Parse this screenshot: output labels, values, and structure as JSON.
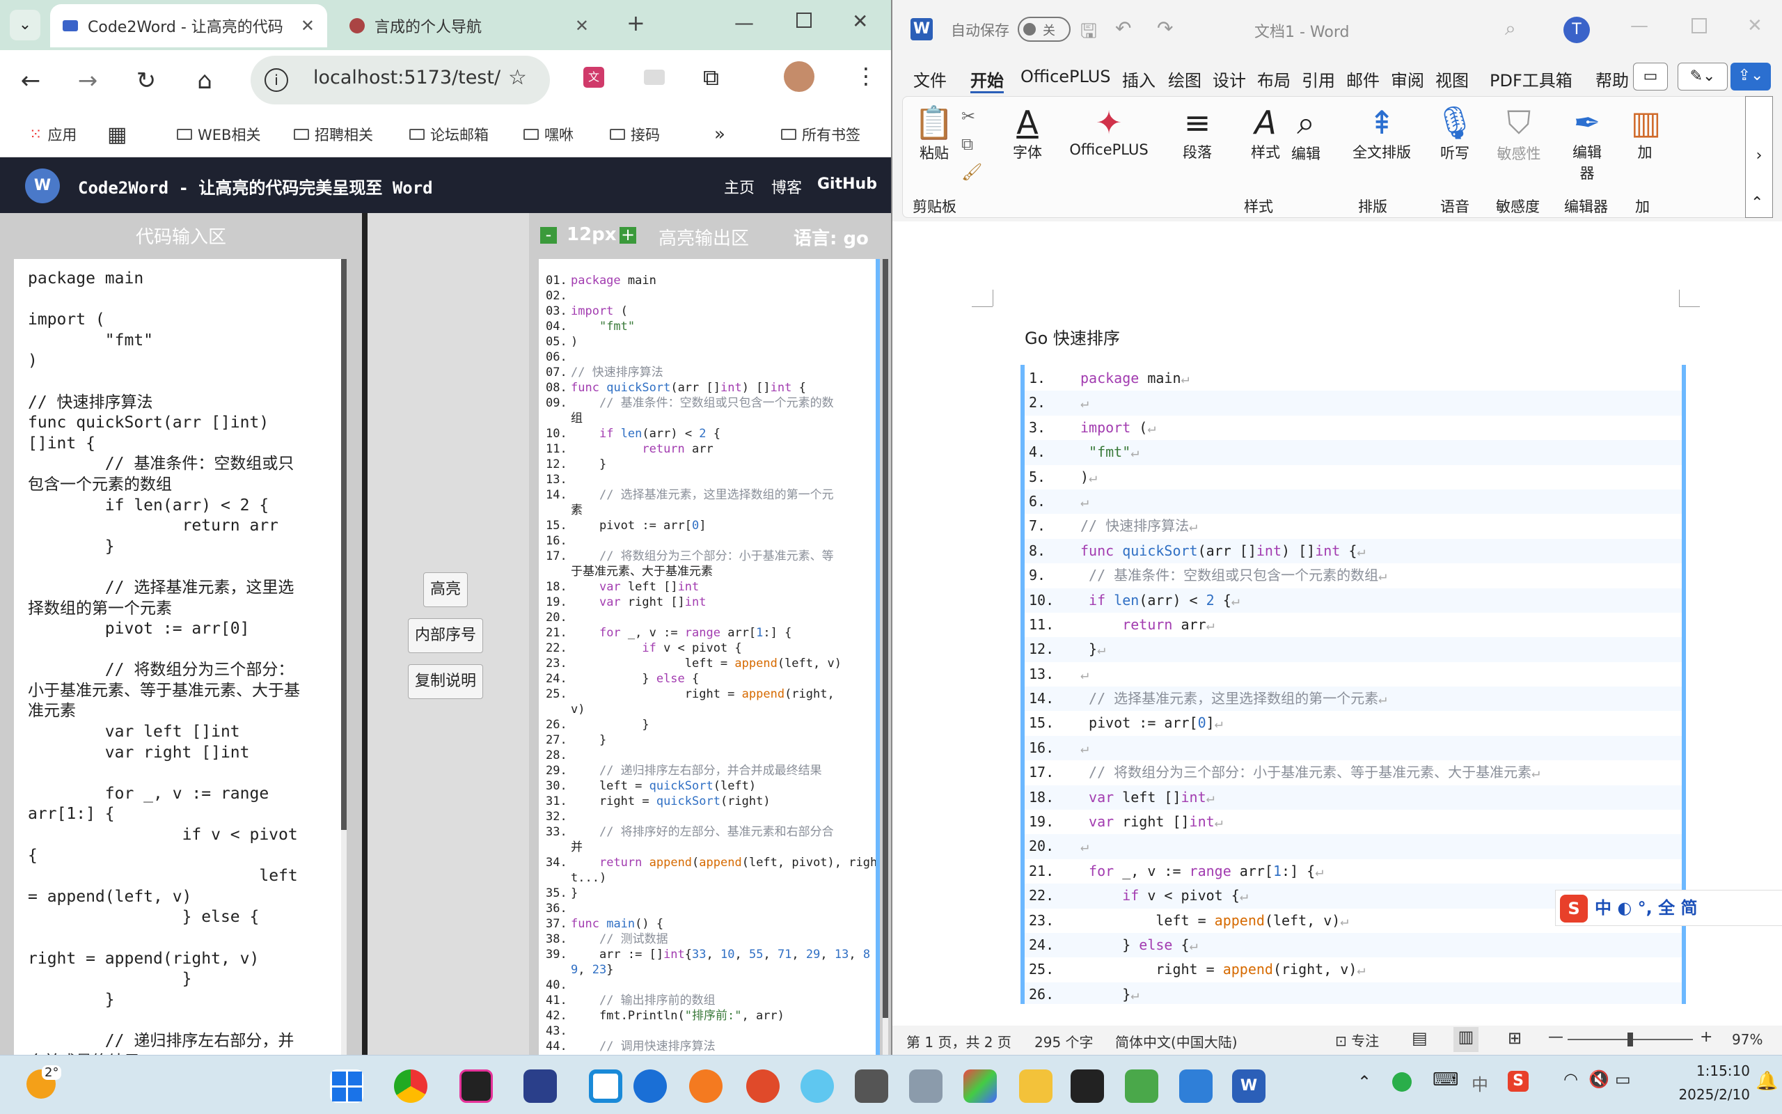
{
  "browser": {
    "tabs": [
      {
        "title": "Code2Word - 让高亮的代码"
      },
      {
        "title": "言成的个人导航"
      }
    ],
    "url": "localhost:5173/test/",
    "bookmarks": [
      "应用",
      "WEB相关",
      "招聘相关",
      "论坛邮箱",
      "嘿咻",
      "接码"
    ],
    "all_bookmarks": "所有书签",
    "more": "»"
  },
  "app": {
    "logo": "W",
    "title": "Code2Word - 让高亮的代码完美呈现至 Word",
    "nav": [
      "主页",
      "博客",
      "GitHub"
    ],
    "input_title": "代码输入区",
    "output_title": "高亮输出区",
    "font_size": "12px",
    "minus": "-",
    "plus": "+",
    "lang_label": "语言: go",
    "buttons": {
      "highlight": "高亮",
      "line_numbers": "内部序号",
      "copy_help": "复制说明"
    },
    "source_lines": [
      "package main",
      "",
      "import (",
      "        \"fmt\"",
      ")",
      "",
      "// 快速排序算法",
      "func quickSort(arr []int) []int {",
      "        // 基准条件：空数组或只包含一个元素的数组",
      "        if len(arr) < 2 {",
      "                return arr",
      "        }",
      "",
      "        // 选择基准元素，这里选择数组的第一个元素",
      "        pivot := arr[0]",
      "",
      "        // 将数组分为三个部分：小于基准元素、等于基准元素、大于基准元素",
      "        var left []int",
      "        var right []int",
      "",
      "        for _, v := range arr[1:] {",
      "                if v < pivot {",
      "                        left = append(left, v)",
      "                } else {",
      "                        right = append(right, v)",
      "                }",
      "        }",
      "",
      "        // 递归排序左右部分，并合并成最终结果"
    ],
    "output_lines": [
      {
        "n": "01.",
        "t": "package main"
      },
      {
        "n": "02.",
        "t": ""
      },
      {
        "n": "03.",
        "t": "import ("
      },
      {
        "n": "04.",
        "t": "    \"fmt\""
      },
      {
        "n": "05.",
        "t": ")"
      },
      {
        "n": "06.",
        "t": ""
      },
      {
        "n": "07.",
        "t": "// 快速排序算法"
      },
      {
        "n": "08.",
        "t": "func quickSort(arr []int) []int {"
      },
      {
        "n": "09.",
        "t": "    // 基准条件：空数组或只包含一个元素的数"
      },
      {
        "n": "",
        "t": "组"
      },
      {
        "n": "10.",
        "t": "    if len(arr) < 2 {"
      },
      {
        "n": "11.",
        "t": "          return arr"
      },
      {
        "n": "12.",
        "t": "    }"
      },
      {
        "n": "13.",
        "t": ""
      },
      {
        "n": "14.",
        "t": "    // 选择基准元素，这里选择数组的第一个元"
      },
      {
        "n": "",
        "t": "素"
      },
      {
        "n": "15.",
        "t": "    pivot := arr[0]"
      },
      {
        "n": "16.",
        "t": ""
      },
      {
        "n": "17.",
        "t": "    // 将数组分为三个部分：小于基准元素、等"
      },
      {
        "n": "",
        "t": "于基准元素、大于基准元素"
      },
      {
        "n": "18.",
        "t": "    var left []int"
      },
      {
        "n": "19.",
        "t": "    var right []int"
      },
      {
        "n": "20.",
        "t": ""
      },
      {
        "n": "21.",
        "t": "    for _, v := range arr[1:] {"
      },
      {
        "n": "22.",
        "t": "          if v < pivot {"
      },
      {
        "n": "23.",
        "t": "                left = append(left, v)"
      },
      {
        "n": "24.",
        "t": "          } else {"
      },
      {
        "n": "25.",
        "t": "                right = append(right,"
      },
      {
        "n": "",
        "t": "v)"
      },
      {
        "n": "26.",
        "t": "          }"
      },
      {
        "n": "27.",
        "t": "    }"
      },
      {
        "n": "28.",
        "t": ""
      },
      {
        "n": "29.",
        "t": "    // 递归排序左右部分，并合并成最终结果"
      },
      {
        "n": "30.",
        "t": "    left = quickSort(left)"
      },
      {
        "n": "31.",
        "t": "    right = quickSort(right)"
      },
      {
        "n": "32.",
        "t": ""
      },
      {
        "n": "33.",
        "t": "    // 将排序好的左部分、基准元素和右部分合"
      },
      {
        "n": "",
        "t": "并"
      },
      {
        "n": "34.",
        "t": "    return append(append(left, pivot), righ"
      },
      {
        "n": "",
        "t": "t...)"
      },
      {
        "n": "35.",
        "t": "}"
      },
      {
        "n": "36.",
        "t": ""
      },
      {
        "n": "37.",
        "t": "func main() {"
      },
      {
        "n": "38.",
        "t": "    // 测试数据"
      },
      {
        "n": "39.",
        "t": "    arr := []int{33, 10, 55, 71, 29, 13, 8"
      },
      {
        "n": "",
        "t": "9, 23}"
      },
      {
        "n": "40.",
        "t": ""
      },
      {
        "n": "41.",
        "t": "    // 输出排序前的数组"
      },
      {
        "n": "42.",
        "t": "    fmt.Println(\"排序前:\", arr)"
      },
      {
        "n": "43.",
        "t": ""
      },
      {
        "n": "44.",
        "t": "    // 调用快速排序算法"
      }
    ]
  },
  "word": {
    "autosave": "自动保存",
    "autosave_state": "关",
    "doc_title": "文档1 - Word",
    "user_initial": "T",
    "menus": [
      "文件",
      "开始",
      "OfficePLUS",
      "插入",
      "绘图",
      "设计",
      "布局",
      "引用",
      "邮件",
      "审阅",
      "视图",
      "PDF工具箱",
      "帮助"
    ],
    "ribbon": {
      "paste": "粘贴",
      "font": "字体",
      "officeplus": "OfficePLUS",
      "paragraph": "段落",
      "styles": "样式",
      "edit": "编辑",
      "layout": "全文排版",
      "dictate": "听写",
      "sensitivity": "敏感性",
      "editor": "编辑器",
      "addins": "加"
    },
    "ribbon_groups": [
      "剪贴板",
      "样式",
      "排版",
      "语音",
      "敏感度",
      "编辑器",
      "加"
    ],
    "heading": "Go 快速排序",
    "code_lines": [
      {
        "n": "1.",
        "t": "package main"
      },
      {
        "n": "2.",
        "t": ""
      },
      {
        "n": "3.",
        "t": "import ("
      },
      {
        "n": "4.",
        "t": " \"fmt\""
      },
      {
        "n": "5.",
        "t": ")"
      },
      {
        "n": "6.",
        "t": ""
      },
      {
        "n": "7.",
        "t": "// 快速排序算法"
      },
      {
        "n": "8.",
        "t": "func quickSort(arr []int) []int {"
      },
      {
        "n": "9.",
        "t": " // 基准条件：空数组或只包含一个元素的数组"
      },
      {
        "n": "10.",
        "t": " if len(arr) < 2 {"
      },
      {
        "n": "11.",
        "t": "     return arr"
      },
      {
        "n": "12.",
        "t": " }"
      },
      {
        "n": "13.",
        "t": ""
      },
      {
        "n": "14.",
        "t": " // 选择基准元素，这里选择数组的第一个元素"
      },
      {
        "n": "15.",
        "t": " pivot := arr[0]"
      },
      {
        "n": "16.",
        "t": ""
      },
      {
        "n": "17.",
        "t": " // 将数组分为三个部分：小于基准元素、等于基准元素、大于基准元素"
      },
      {
        "n": "18.",
        "t": " var left []int"
      },
      {
        "n": "19.",
        "t": " var right []int"
      },
      {
        "n": "20.",
        "t": ""
      },
      {
        "n": "21.",
        "t": " for _, v := range arr[1:] {"
      },
      {
        "n": "22.",
        "t": "     if v < pivot {"
      },
      {
        "n": "23.",
        "t": "         left = append(left, v)"
      },
      {
        "n": "24.",
        "t": "     } else {"
      },
      {
        "n": "25.",
        "t": "         right = append(right, v)"
      },
      {
        "n": "26.",
        "t": "     }"
      }
    ],
    "ime": "中 ◐ °, 全 简",
    "status": {
      "page": "第 1 页，共 2 页",
      "words": "295 个字",
      "lang": "简体中文(中国大陆)",
      "focus": "专注",
      "zoom": "97%"
    }
  },
  "taskbar": {
    "weather": "2°",
    "time": "1:15:10",
    "date": "2025/2/10",
    "ime_lang": "中"
  }
}
